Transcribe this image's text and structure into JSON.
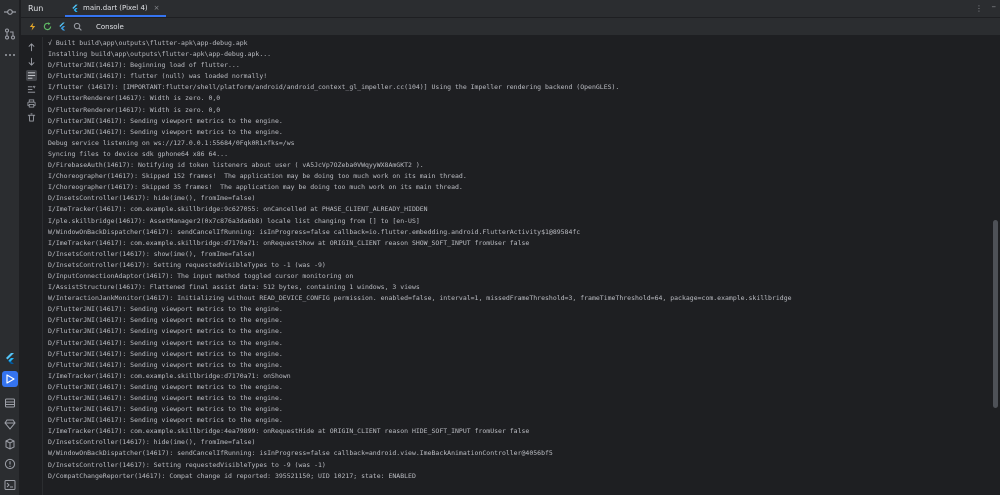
{
  "tool_window": {
    "title": "Run",
    "run_tab_label": "main.dart (Pixel 4)",
    "run_tab_close": "×",
    "options_label": "⋮",
    "minimize_label": "–",
    "console_tab_label": "Console"
  },
  "colors": {
    "accent": "#3574f0",
    "background": "#1e1f22",
    "panel": "#2b2d30",
    "text": "#bcbec4",
    "hot_reload": "#e2a52a",
    "hot_restart": "#5fb865"
  },
  "activity_bar": {
    "top_icons": [
      "commit-icon",
      "pull-requests-icon",
      "more-icon"
    ],
    "bottom_icons": [
      "flutter-icon",
      "run-icon",
      "services-icon",
      "terminal-icon",
      "problems-icon",
      "build-icon",
      "info-icon",
      "terminal-window-icon"
    ]
  },
  "console": {
    "lines": [
      "√ Built build\\app\\outputs\\flutter-apk\\app-debug.apk",
      "Installing build\\app\\outputs\\flutter-apk\\app-debug.apk...",
      "D/FlutterJNI(14617): Beginning load of flutter...",
      "D/FlutterJNI(14617): flutter (null) was loaded normally!",
      "I/flutter (14617): [IMPORTANT:flutter/shell/platform/android/android_context_gl_impeller.cc(104)] Using the Impeller rendering backend (OpenGLES).",
      "D/FlutterRenderer(14617): Width is zero. 0,0",
      "D/FlutterRenderer(14617): Width is zero. 0,0",
      "D/FlutterJNI(14617): Sending viewport metrics to the engine.",
      "D/FlutterJNI(14617): Sending viewport metrics to the engine.",
      "Debug service listening on ws://127.0.0.1:55684/0Fqk0R1xfks=/ws",
      "Syncing files to device sdk gphone64 x86 64...",
      "D/FirebaseAuth(14617): Notifying id token listeners about user ( vA5JcVp7OZeba0VWqyyWX8AmGKT2 ).",
      "I/Choreographer(14617): Skipped 152 frames!  The application may be doing too much work on its main thread.",
      "I/Choreographer(14617): Skipped 35 frames!  The application may be doing too much work on its main thread.",
      "D/InsetsController(14617): hide(ime(), fromIme=false)",
      "I/ImeTracker(14617): com.example.skillbridge:9c627055: onCancelled at PHASE_CLIENT_ALREADY_HIDDEN",
      "I/ple.skillbridge(14617): AssetManager2(0x7c876a3da6b8) locale list changing from [] to [en-US]",
      "W/WindowOnBackDispatcher(14617): sendCancelIfRunning: isInProgress=false callback=io.flutter.embedding.android.FlutterActivity$1@89584fc",
      "I/ImeTracker(14617): com.example.skillbridge:d7170a71: onRequestShow at ORIGIN_CLIENT reason SHOW_SOFT_INPUT fromUser false",
      "D/InsetsController(14617): show(ime(), fromIme=false)",
      "D/InsetsController(14617): Setting requestedVisibleTypes to -1 (was -9)",
      "D/InputConnectionAdaptor(14617): The input method toggled cursor monitoring on",
      "I/AssistStructure(14617): Flattened final assist data: 512 bytes, containing 1 windows, 3 views",
      "W/InteractionJankMonitor(14617): Initializing without READ_DEVICE_CONFIG permission. enabled=false, interval=1, missedFrameThreshold=3, frameTimeThreshold=64, package=com.example.skillbridge",
      "D/FlutterJNI(14617): Sending viewport metrics to the engine.",
      "D/FlutterJNI(14617): Sending viewport metrics to the engine.",
      "D/FlutterJNI(14617): Sending viewport metrics to the engine.",
      "D/FlutterJNI(14617): Sending viewport metrics to the engine.",
      "D/FlutterJNI(14617): Sending viewport metrics to the engine.",
      "D/FlutterJNI(14617): Sending viewport metrics to the engine.",
      "I/ImeTracker(14617): com.example.skillbridge:d7170a71: onShown",
      "D/FlutterJNI(14617): Sending viewport metrics to the engine.",
      "D/FlutterJNI(14617): Sending viewport metrics to the engine.",
      "D/FlutterJNI(14617): Sending viewport metrics to the engine.",
      "D/FlutterJNI(14617): Sending viewport metrics to the engine.",
      "I/ImeTracker(14617): com.example.skillbridge:4ea79899: onRequestHide at ORIGIN_CLIENT reason HIDE_SOFT_INPUT fromUser false",
      "D/InsetsController(14617): hide(ime(), fromIme=false)",
      "W/WindowOnBackDispatcher(14617): sendCancelIfRunning: isInProgress=false callback=android.view.ImeBackAnimationController@4056bf5",
      "D/InsetsController(14617): Setting requestedVisibleTypes to -9 (was -1)",
      "D/CompatChangeReporter(14617): Compat change id reported: 395521150; UID 10217; state: ENABLED"
    ]
  }
}
